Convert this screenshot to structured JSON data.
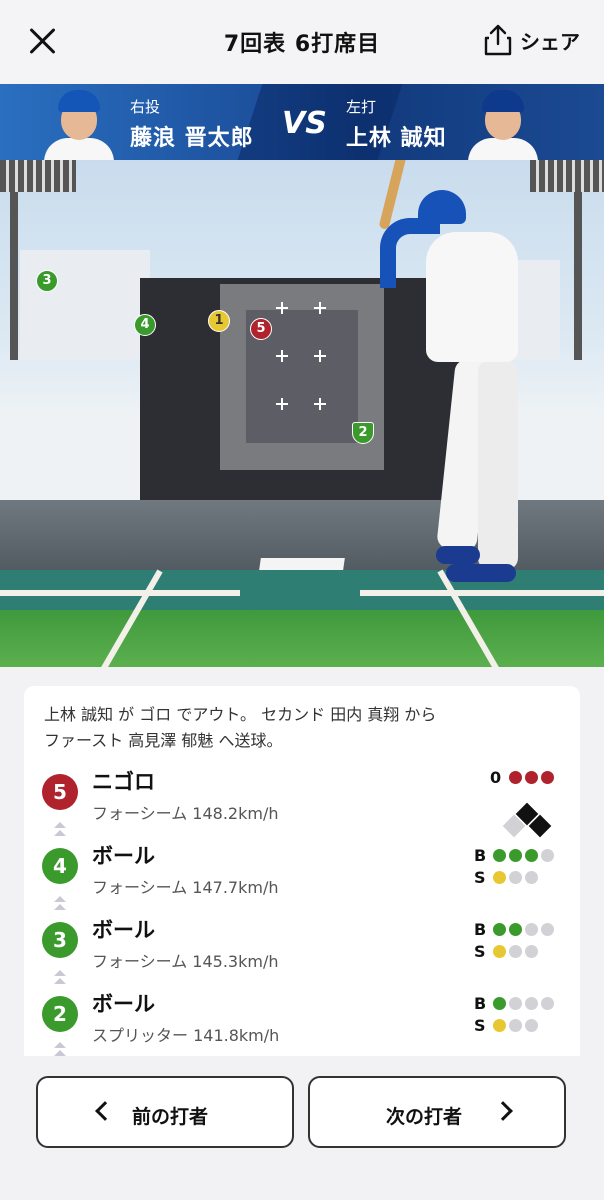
{
  "header": {
    "title": "7回表 6打席目",
    "share_label": "シェア"
  },
  "matchup": {
    "pitcher_role": "右投",
    "pitcher_name": "藤浪 晋太郎",
    "vs": "VS",
    "batter_role": "左打",
    "batter_name": "上林 誠知"
  },
  "field": {
    "pitches": [
      {
        "label": "5",
        "color": "#b0222c"
      },
      {
        "label": "1",
        "color": "#e8c832"
      },
      {
        "label": "4",
        "color": "#3a9a2c"
      },
      {
        "label": "3",
        "color": "#3a9a2c"
      },
      {
        "label": "2",
        "color": "#3a9a2c"
      }
    ]
  },
  "play": {
    "summary_line1": "上林 誠知 が ゴロ でアウト。 セカンド 田内 真翔 から",
    "summary_line2": "ファースト 高見澤 郁魅 へ送球。",
    "pitches": [
      {
        "number": "5",
        "result": "ニゴロ",
        "detail": "フォーシーム 148.2km/h",
        "color": "#b0222c",
        "outs_label": "0"
      },
      {
        "number": "4",
        "result": "ボール",
        "detail": "フォーシーム 147.7km/h",
        "color": "#3a9a2c",
        "b_label": "B",
        "s_label": "S"
      },
      {
        "number": "3",
        "result": "ボール",
        "detail": "フォーシーム 145.3km/h",
        "color": "#3a9a2c",
        "b_label": "B",
        "s_label": "S"
      },
      {
        "number": "2",
        "result": "ボール",
        "detail": "スプリッター 141.8km/h",
        "color": "#3a9a2c",
        "b_label": "B",
        "s_label": "S"
      }
    ],
    "counts": [
      {
        "outs": 3
      },
      {
        "balls": 3,
        "strikes": 1
      },
      {
        "balls": 2,
        "strikes": 1
      },
      {
        "balls": 1,
        "strikes": 1
      }
    ]
  },
  "nav": {
    "prev_label": "前の打者",
    "next_label": "次の打者"
  },
  "colors": {
    "ball": "#3a9a2c",
    "strike": "#e8c832",
    "out": "#b0222c",
    "accent": "#1652b7"
  }
}
